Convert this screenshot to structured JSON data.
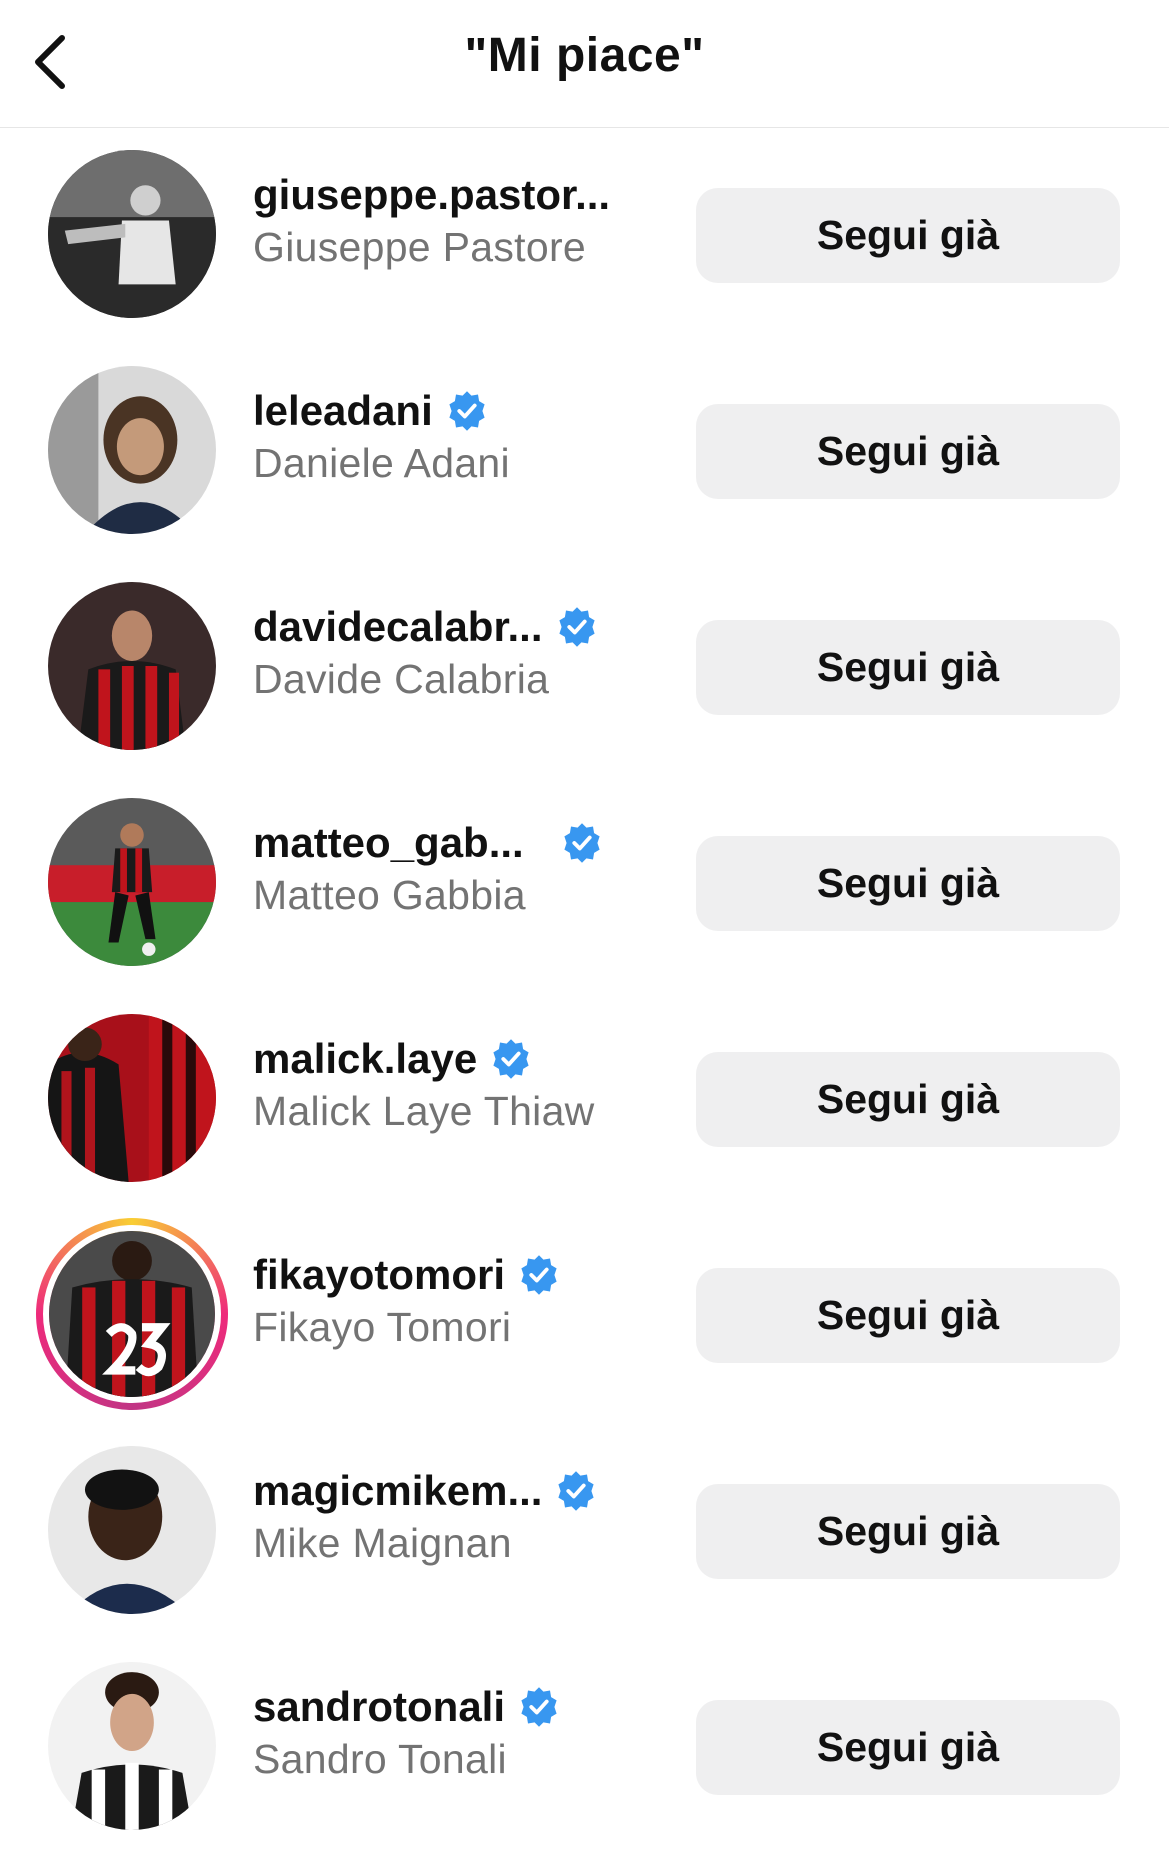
{
  "header": {
    "title": "\"Mi piace\"",
    "back_icon": "chevron-left-icon"
  },
  "colors": {
    "verified_blue": "#3897f0",
    "button_bg": "#efeff0",
    "secondary_text": "#737373",
    "story_ring": "#ee2a7b"
  },
  "users": [
    {
      "username": "giuseppe.pastor...",
      "fullname": "Giuseppe Pastore",
      "verified": false,
      "story_ring": false,
      "button": "Segui già"
    },
    {
      "username": "leleadani",
      "fullname": "Daniele Adani",
      "verified": true,
      "story_ring": false,
      "button": "Segui già"
    },
    {
      "username": "davidecalabr...",
      "fullname": "Davide Calabria",
      "verified": true,
      "story_ring": false,
      "button": "Segui già"
    },
    {
      "username": "matteo_gab...",
      "fullname": "Matteo Gabbia",
      "verified": true,
      "story_ring": false,
      "button": "Segui già"
    },
    {
      "username": "malick.laye",
      "fullname": "Malick Laye Thiaw",
      "verified": true,
      "story_ring": false,
      "button": "Segui già"
    },
    {
      "username": "fikayotomori",
      "fullname": "Fikayo Tomori",
      "verified": true,
      "story_ring": true,
      "button": "Segui già"
    },
    {
      "username": "magicmikem...",
      "fullname": "Mike Maignan",
      "verified": true,
      "story_ring": false,
      "button": "Segui già"
    },
    {
      "username": "sandrotonali",
      "fullname": "Sandro Tonali",
      "verified": true,
      "story_ring": false,
      "button": "Segui già"
    }
  ]
}
